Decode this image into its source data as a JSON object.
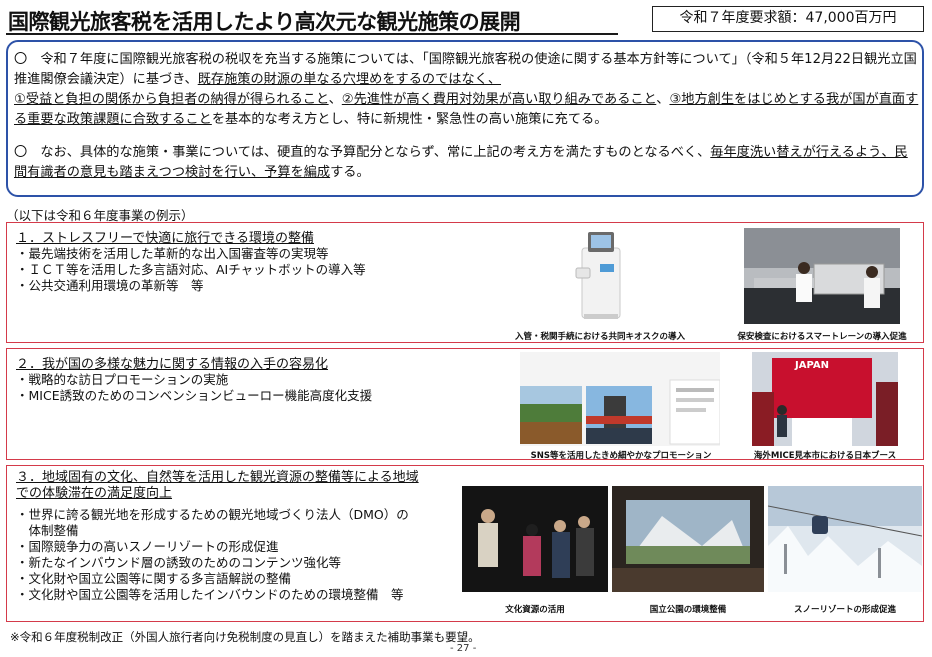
{
  "title": "国際観光旅客税を活用したより高次元な観光施策の展開",
  "budget": "令和７年度要求額：47,000百万円",
  "policy": {
    "p1": [
      "〇　令和７年度に国際観光旅客税の税収を充当する施策については、「国際観光旅客税の使途に関する基本方針等について」（令和５年12月22日観光立国推進閣僚会議決定）に基づき、",
      "既存施策の財源の単なる穴埋めをするのではなく、",
      "①受益と負担の関係から負担者の納得が得られること",
      "、",
      "②先進性が高く費用対効果が高い取り組みであること",
      "、",
      "③地方創生をはじめとする我が国が直面する重要な政策課題に合致すること",
      "を基本的な考え方とし、特に新規性・緊急性の高い施策に充てる。"
    ],
    "p2": [
      "〇　なお、具体的な施策・事業については、硬直的な予算配分とならず、常に上記の考え方を満たすものとなるべく、",
      "毎年度洗い替えが行えるよう、民間有識者の意見も踏まえつつ検討を行い、予算を編成",
      "する。"
    ]
  },
  "examples_heading": "（以下は令和６年度事業の例示）",
  "sections": [
    {
      "title": "１．ストレスフリーで快適に旅行できる環境の整備",
      "bullets": [
        "・最先端技術を活用した革新的な出入国審査等の実現等",
        "・ＩＣＴ等を活用した多言語対応、AIチャットボットの導入等",
        "・公共交通利用環境の革新等　等"
      ],
      "captions": [
        "入管・税関手続における共同キオスクの導入",
        "保安検査におけるスマートレーンの導入促進"
      ]
    },
    {
      "title": "２．我が国の多様な魅力に関する情報の入手の容易化",
      "bullets": [
        "・戦略的な訪日プロモーションの実施",
        "・MICE誘致のためのコンベンションビューロー機能高度化支援"
      ],
      "captions": [
        "SNS等を活用したきめ細やかなプロモーション",
        "海外MICE見本市における日本ブース"
      ],
      "booth_sign": "JAPAN"
    },
    {
      "title_lines": [
        "３．地域固有の文化、自然等を活用した観光資源の整備等による地域",
        "での体験滞在の満足度向上"
      ],
      "bullets": [
        "・世界に誇る観光地を形成するための観光地域づくり法人（DMO）の",
        "　体制整備",
        "・国際競争力の高いスノーリゾートの形成促進",
        "・新たなインバウンド層の誘致のためのコンテンツ強化等",
        "・文化財や国立公園等に関する多言語解説の整備",
        "・文化財や国立公園等を活用したインバウンドのための環境整備　等"
      ],
      "captions": [
        "文化資源の活用",
        "国立公園の環境整備",
        "スノーリゾートの形成促進"
      ]
    }
  ],
  "footnote": "※令和６年度税制改正（外国人旅行者向け免税制度の見直し）を踏まえた補助事業も要望。",
  "page_number": "- 27 -"
}
